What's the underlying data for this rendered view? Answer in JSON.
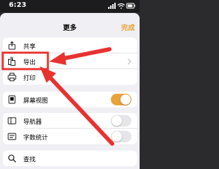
{
  "status_bar": {
    "time": "6:23"
  },
  "sheet": {
    "title": "更多",
    "done_label": "完成"
  },
  "groups": [
    {
      "items": [
        {
          "label": "共享",
          "icon": "share-icon"
        },
        {
          "label": "导出",
          "icon": "export-icon"
        },
        {
          "label": "打印",
          "icon": "print-icon"
        }
      ]
    },
    {
      "items": [
        {
          "label": "屏幕视图",
          "icon": "screen-view-icon",
          "toggle": true
        }
      ]
    },
    {
      "items": [
        {
          "label": "导航器",
          "icon": "navigator-icon",
          "toggle": false
        },
        {
          "label": "字数统计",
          "icon": "word-count-icon",
          "toggle": false
        }
      ]
    },
    {
      "items": [
        {
          "label": "查找",
          "icon": "search-icon"
        }
      ]
    }
  ],
  "colors": {
    "accent": "#e8a33b",
    "annotation": "#e8322f",
    "sheet_background": "#efeff4"
  }
}
